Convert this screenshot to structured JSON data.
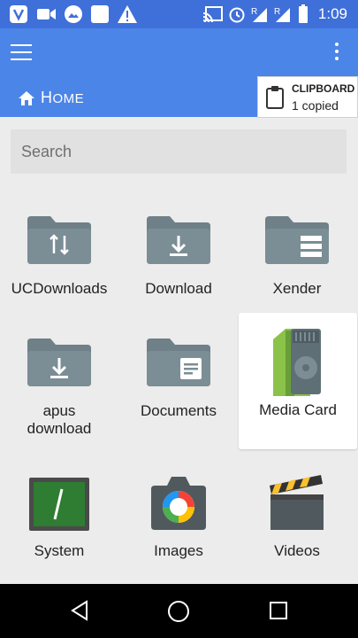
{
  "status_bar": {
    "time": "1:09",
    "icons": [
      "app-logo-icon",
      "video-camera-icon",
      "gallery-icon",
      "blank-app-icon",
      "warning-icon",
      "cast-icon",
      "alarm-icon",
      "signal-r-icon",
      "signal-r-icon",
      "battery-icon"
    ]
  },
  "app_bar": {
    "breadcrumb_initial": "H",
    "breadcrumb_rest": "OME"
  },
  "clipboard": {
    "title": "CLIPBOARD",
    "subtitle": "1 copied"
  },
  "search": {
    "placeholder": "Search"
  },
  "grid": [
    {
      "label": "UCDownloads",
      "icon": "folder-transfer-icon"
    },
    {
      "label": "Download",
      "icon": "folder-download-icon"
    },
    {
      "label": "Xender",
      "icon": "folder-list-icon"
    },
    {
      "label": "apus\ndownload",
      "label_line1": "apus",
      "label_line2": "download",
      "icon": "folder-download-icon"
    },
    {
      "label": "Documents",
      "icon": "folder-document-icon"
    },
    {
      "label": "Media Card",
      "icon": "sd-card-icon"
    },
    {
      "label": "System",
      "icon": "terminal-icon"
    },
    {
      "label": "Images",
      "icon": "camera-icon"
    },
    {
      "label": "Videos",
      "icon": "clapperboard-icon"
    }
  ],
  "colors": {
    "status_bar": "#3f6fd8",
    "app_bar": "#4c85e8",
    "folder": "#6f8088",
    "background": "#ececec"
  }
}
